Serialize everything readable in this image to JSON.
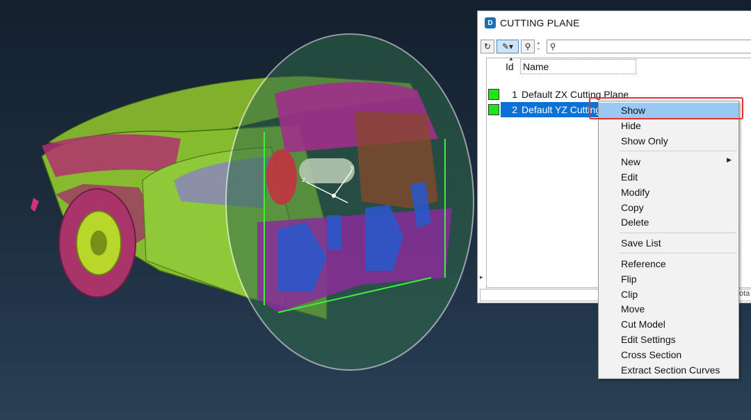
{
  "panel": {
    "title": "CUTTING PLANE",
    "app_icon_text": "D",
    "columns": {
      "id": "Id",
      "name": "Name"
    },
    "rows": [
      {
        "id": "1",
        "name": "Default ZX Cutting Plane",
        "selected": false
      },
      {
        "id": "2",
        "name": "Default YZ Cutting Plane",
        "selected": true
      }
    ],
    "right_fragment": "ota"
  },
  "context_menu": {
    "groups": [
      [
        "Show",
        "Hide",
        "Show Only"
      ],
      [
        "New",
        "Edit",
        "Modify",
        "Copy",
        "Delete"
      ],
      [
        "Save List"
      ],
      [
        "Reference",
        "Flip",
        "Clip",
        "Move",
        "Cut Model",
        "Edit Settings",
        "Cross Section",
        "Extract Section Curves"
      ]
    ],
    "highlighted": "Show",
    "submenu_item": "New"
  },
  "colors": {
    "highlight": "#99c9f2",
    "selection": "#0a72d6",
    "annotation_red": "#e53030",
    "swatch_green": "#1fe51a"
  }
}
